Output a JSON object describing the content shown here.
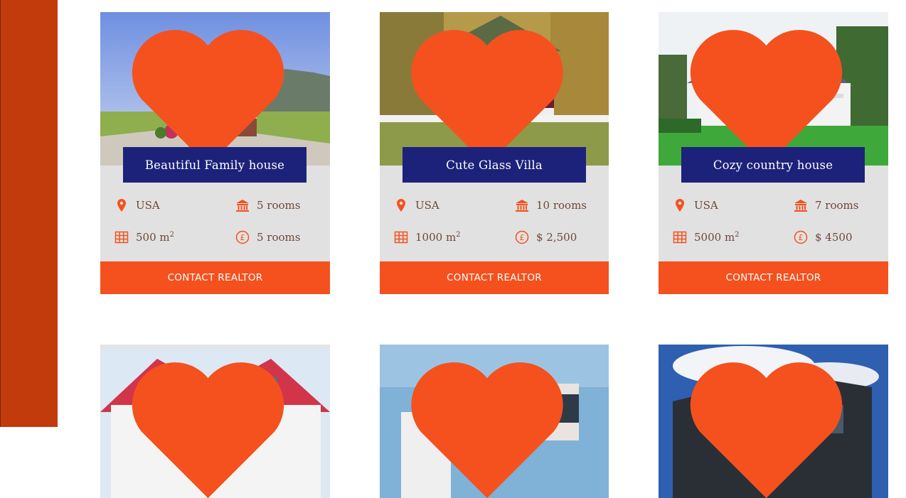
{
  "accent": "#f4511e",
  "sidebar_color": "#c23b0d",
  "title_box_color": "#1c227a",
  "listings": [
    {
      "title": "Beautiful Family house",
      "location": "USA",
      "rooms": "5 rooms",
      "area_value": "500 m",
      "area_sup": "2",
      "price": "5 rooms",
      "contact_label": "CONTACT REALTOR"
    },
    {
      "title": "Cute Glass Villa",
      "location": "USA",
      "rooms": "10 rooms",
      "area_value": "1000 m",
      "area_sup": "2",
      "price": "$ 2,500",
      "contact_label": "CONTACT REALTOR"
    },
    {
      "title": "Cozy country house",
      "location": "USA",
      "rooms": "7 rooms",
      "area_value": "5000 m",
      "area_sup": "2",
      "price": "$ 4500",
      "contact_label": "CONTACT REALTOR"
    }
  ],
  "icons": {
    "favorite": "heart-icon",
    "location": "map-pin-icon",
    "rooms": "bank-icon",
    "area": "grid-icon",
    "price": "currency-icon"
  }
}
